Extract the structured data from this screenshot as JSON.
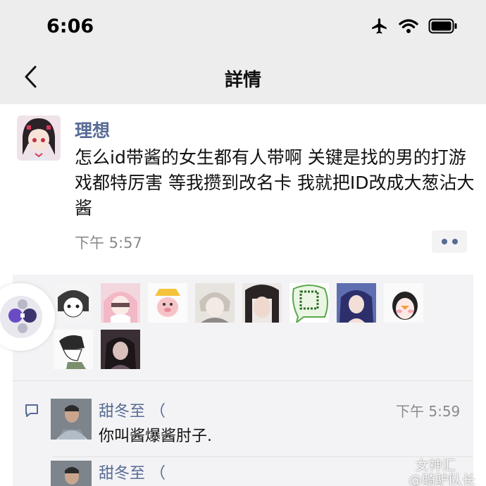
{
  "status_bar": {
    "time": "6:06",
    "icons": [
      "airplane-icon",
      "wifi-icon",
      "battery-icon"
    ]
  },
  "nav": {
    "title": "詳情",
    "back_icon": "chevron-left-icon"
  },
  "post": {
    "author": "理想",
    "content": "怎么id带酱的女生都有人带啊 关键是找的男的打游戏都特厉害 等我攒到改名卡 我就把ID改成大葱沾大酱",
    "time": "下午 5:57"
  },
  "likes": {
    "count": 10
  },
  "comments": [
    {
      "name": "甜冬至 （",
      "time": "下午 5:59",
      "text": "你叫酱爆酱肘子."
    },
    {
      "name": "甜冬至 （",
      "time": "",
      "text": ""
    }
  ],
  "watermark": {
    "line1": "女神汇",
    "line2": "@骑驴队长"
  },
  "colors": {
    "link": "#576b95",
    "nav_bg": "#ededed",
    "panel_bg": "#f3f3f5"
  }
}
